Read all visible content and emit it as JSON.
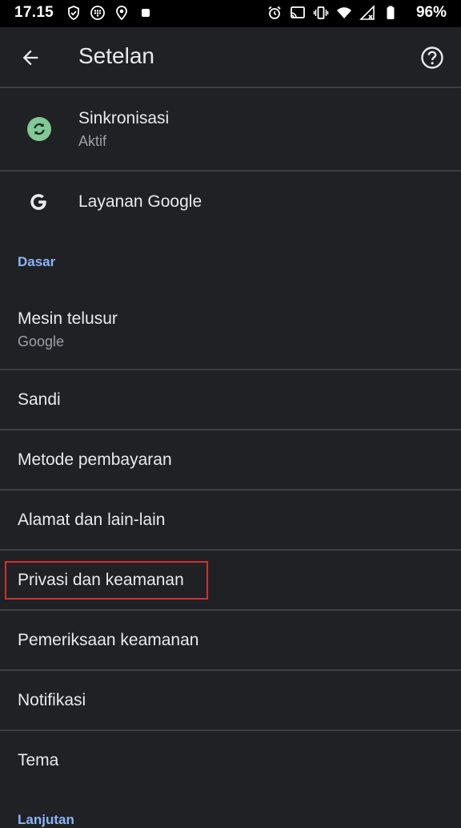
{
  "status_bar": {
    "time": "17.15",
    "battery_percent": "96%"
  },
  "app_bar": {
    "title": "Setelan"
  },
  "account": {
    "sync_title": "Sinkronisasi",
    "sync_status": "Aktif",
    "google_services": "Layanan Google"
  },
  "sections": {
    "basic": "Dasar",
    "advanced": "Lanjutan"
  },
  "basic_items": {
    "search_engine": "Mesin telusur",
    "search_engine_value": "Google",
    "passwords": "Sandi",
    "payment_methods": "Metode pembayaran",
    "addresses": "Alamat dan lain-lain",
    "privacy": "Privasi dan keamanan",
    "safety_check": "Pemeriksaan keamanan",
    "notifications": "Notifikasi",
    "theme": "Tema"
  },
  "colors": {
    "background": "#202124",
    "accent_blue": "#8ab4f8",
    "sync_green": "#81c995",
    "highlight_red": "#d32f2f"
  },
  "icons": [
    "back-arrow-icon",
    "help-icon",
    "sync-icon",
    "google-g-icon"
  ]
}
